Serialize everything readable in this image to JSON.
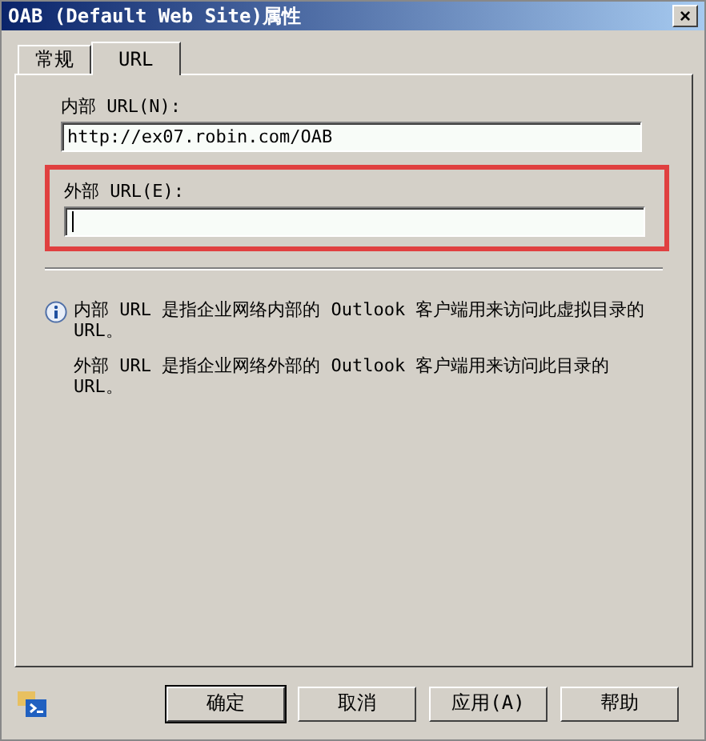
{
  "window": {
    "title": "OAB (Default Web Site)属性",
    "close": "×"
  },
  "tabs": [
    {
      "label": "常规",
      "selected": false
    },
    {
      "label": "URL",
      "selected": true
    }
  ],
  "fields": [
    {
      "label": "内部 URL(N):",
      "value": "http://ex07.robin.com/OAB",
      "focused": false,
      "highlighted": false
    },
    {
      "label": "外部 URL(E):",
      "focused": true,
      "highlighted": true
    }
  ],
  "info": [
    "内部 URL 是指企业网络内部的 Outlook 客户端用来访问此虚拟目录的 URL。",
    "外部 URL 是指企业网络外部的 Outlook 客户端用来访问此目录的 URL。"
  ],
  "buttons": [
    {
      "label": "确定",
      "default": true
    },
    {
      "label": "取消",
      "default": false
    },
    {
      "label": "应用(A)",
      "default": false
    },
    {
      "label": "帮助",
      "default": false
    }
  ]
}
